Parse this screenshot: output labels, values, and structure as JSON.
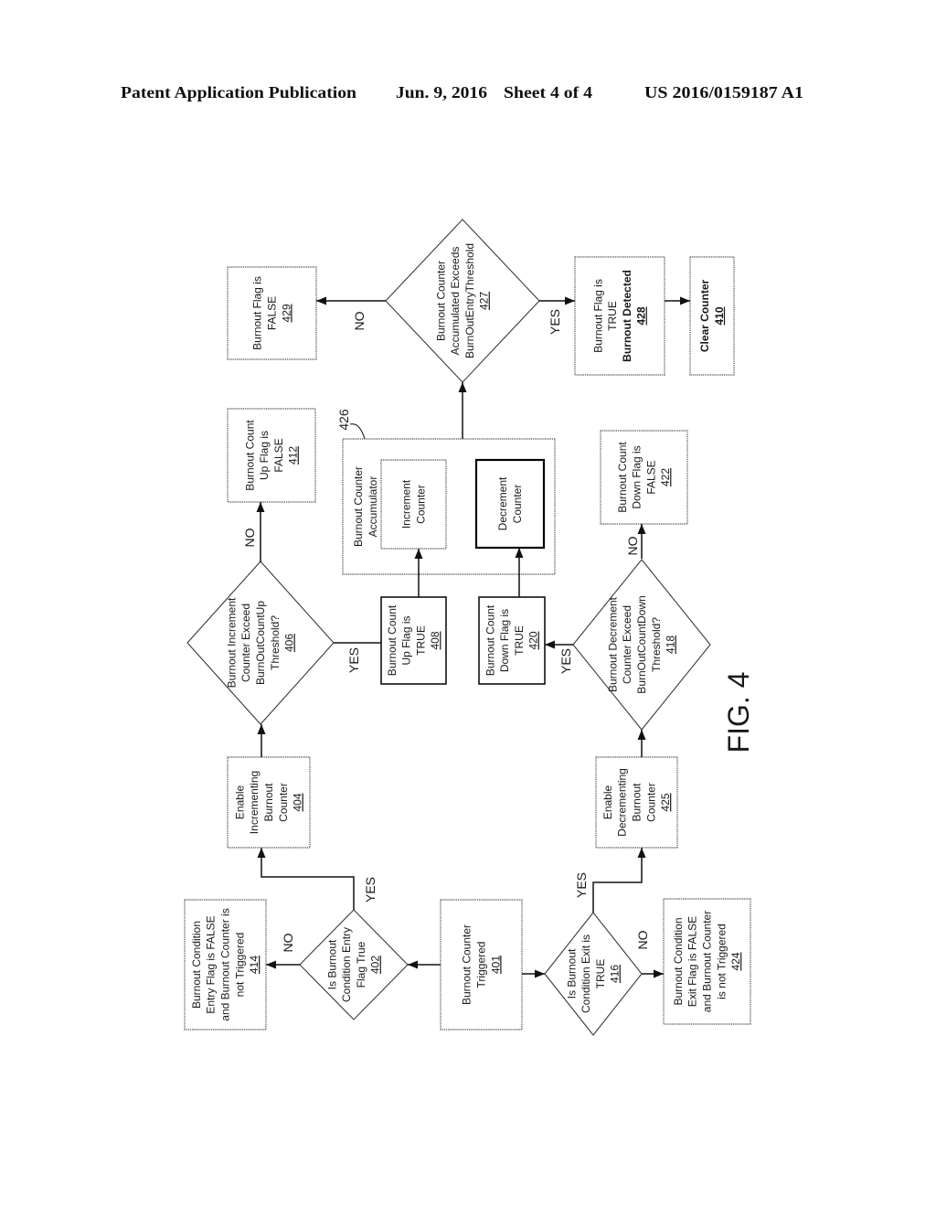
{
  "header": {
    "publication": "Patent Application Publication",
    "date": "Jun. 9, 2016",
    "sheet": "Sheet 4 of 4",
    "number": "US 2016/0159187 A1"
  },
  "figure": {
    "label": "FIG. 4"
  },
  "nodes": [
    {
      "ref": "401",
      "shape": "process",
      "lines": [
        "Burnout Counter",
        "Triggered"
      ]
    },
    {
      "ref": "402",
      "shape": "decision",
      "lines": [
        "Is Burnout",
        "Condition Entry",
        "Flag True"
      ]
    },
    {
      "ref": "404",
      "shape": "process",
      "lines": [
        "Enable",
        "Incrementing",
        "Burnout",
        "Counter"
      ]
    },
    {
      "ref": "406",
      "shape": "decision",
      "lines": [
        "Burnout Increment",
        "Counter Exceed",
        "BurnOutCountUp",
        "Threshold?"
      ]
    },
    {
      "ref": "408",
      "shape": "process",
      "lines": [
        "Burnout Count",
        "Up Flag is",
        "TRUE"
      ]
    },
    {
      "ref": "410",
      "shape": "process",
      "lines": [
        "Clear Counter"
      ]
    },
    {
      "ref": "412",
      "shape": "process",
      "lines": [
        "Burnout Count",
        "Up Flag is",
        "FALSE"
      ]
    },
    {
      "ref": "414",
      "shape": "process",
      "lines": [
        "Burnout Condition",
        "Entry Flag is FALSE",
        "and Burnout Counter is",
        "not Triggered"
      ]
    },
    {
      "ref": "416",
      "shape": "decision",
      "lines": [
        "Is Burnout",
        "Condition Exit is",
        "TRUE"
      ]
    },
    {
      "ref": "418",
      "shape": "decision",
      "lines": [
        "Burnout Decrement",
        "Counter Exceed",
        "BurnOutCountDown",
        "Threshold?"
      ]
    },
    {
      "ref": "420",
      "shape": "process",
      "lines": [
        "Burnout Count",
        "Down Flag is",
        "TRUE"
      ]
    },
    {
      "ref": "422",
      "shape": "process",
      "lines": [
        "Burnout Count",
        "Down Flag is",
        "FALSE"
      ]
    },
    {
      "ref": "424",
      "shape": "process",
      "lines": [
        "Burnout Condition",
        "Exit Flag is FALSE",
        "and Burnout Counter",
        "is not Triggered"
      ]
    },
    {
      "ref": "425",
      "shape": "process",
      "lines": [
        "Enable",
        "Decrementing",
        "Burnout",
        "Counter"
      ]
    },
    {
      "ref": "427",
      "shape": "decision",
      "lines": [
        "Burnout Counter",
        "Accumulated Exceeds",
        "BurnOutEntryThreshold"
      ]
    },
    {
      "ref": "428",
      "shape": "process",
      "lines": [
        "Burnout Flag is",
        "TRUE",
        "Burnout Detected"
      ]
    },
    {
      "ref": "429",
      "shape": "process",
      "lines": [
        "Burnout Flag is",
        "FALSE"
      ]
    }
  ],
  "accumulator": {
    "ref": "426",
    "title": [
      "Burnout Counter",
      "Accumulator"
    ],
    "increment_counter": {
      "lines": [
        "Increment",
        "Counter"
      ]
    },
    "decrement_counter": {
      "lines": [
        "Decrement",
        "Counter"
      ]
    }
  },
  "edges": [
    {
      "from": "401",
      "to": "402"
    },
    {
      "from": "401",
      "to": "416"
    },
    {
      "from": "402",
      "to": "414",
      "label": "NO"
    },
    {
      "from": "402",
      "to": "404",
      "label": "YES"
    },
    {
      "from": "404",
      "to": "406"
    },
    {
      "from": "406",
      "to": "412",
      "label": "NO"
    },
    {
      "from": "406",
      "to": "408",
      "label": "YES"
    },
    {
      "from": "408",
      "to": "increment_counter"
    },
    {
      "from": "416",
      "to": "424",
      "label": "NO"
    },
    {
      "from": "416",
      "to": "425",
      "label": "YES"
    },
    {
      "from": "425",
      "to": "418"
    },
    {
      "from": "418",
      "to": "422",
      "label": "NO"
    },
    {
      "from": "418",
      "to": "420",
      "label": "YES"
    },
    {
      "from": "420",
      "to": "decrement_counter"
    },
    {
      "from": "426",
      "to": "427"
    },
    {
      "from": "427",
      "to": "429",
      "label": "NO"
    },
    {
      "from": "427",
      "to": "428",
      "label": "YES"
    },
    {
      "from": "428",
      "to": "410"
    }
  ]
}
